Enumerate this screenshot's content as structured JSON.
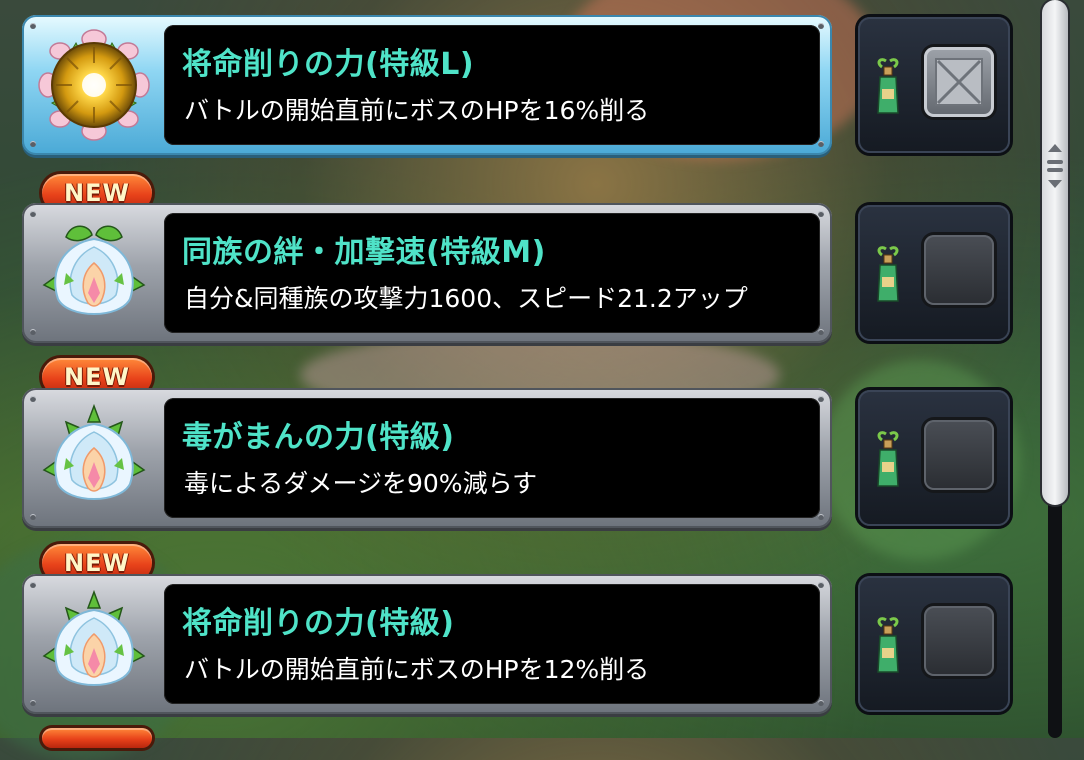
{
  "new_badge_label": "NEW",
  "skills": [
    {
      "title": "将命削りの力(特級L)",
      "description": "バトルの開始直前にボスのHPを16%削る",
      "is_new": false,
      "selected": true,
      "checked": true,
      "icon": "golden-sun-orb-icon"
    },
    {
      "title": "同族の絆・加撃速(特級M)",
      "description": "自分&同種族の攻撃力1600、スピード21.2アップ",
      "is_new": true,
      "selected": false,
      "checked": false,
      "icon": "lotus-crystal-icon"
    },
    {
      "title": "毒がまんの力(特級)",
      "description": "毒によるダメージを90%減らす",
      "is_new": true,
      "selected": false,
      "checked": false,
      "icon": "lotus-crystal-icon"
    },
    {
      "title": "将命削りの力(特級)",
      "description": "バトルの開始直前にボスのHPを12%削る",
      "is_new": true,
      "selected": false,
      "checked": false,
      "icon": "lotus-crystal-icon"
    }
  ],
  "colors": {
    "title_color": "#4fe3c8",
    "new_badge_color": "#e8421a",
    "selected_card_color": "#8fd6f3"
  }
}
